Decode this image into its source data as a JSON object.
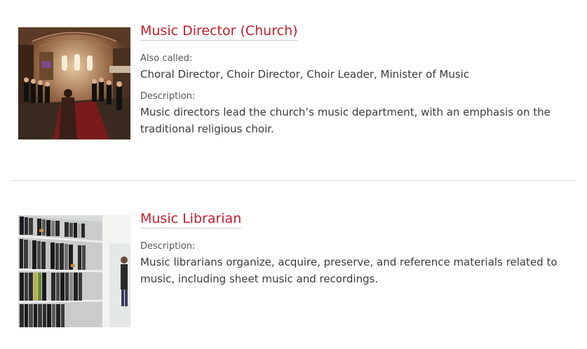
{
  "careers": [
    {
      "title": "Music Director (Church)",
      "image_alt": "church-choir-photo",
      "also_called_label": "Also called:",
      "also_called": "Choral Director, Choir Director, Choir Leader, Minister of Music",
      "description_label": "Description:",
      "description": "Music directors lead the church’s music department, with an emphasis on the traditional religious choir."
    },
    {
      "title": "Music Librarian",
      "image_alt": "library-shelves-photo",
      "description_label": "Description:",
      "description": "Music librarians organize, acquire, preserve, and reference materials related to music, including sheet music and recordings."
    }
  ],
  "colors": {
    "title": "#c41e2a",
    "text": "#3a3a3a",
    "label": "#555555",
    "divider": "#e0e0e0"
  }
}
